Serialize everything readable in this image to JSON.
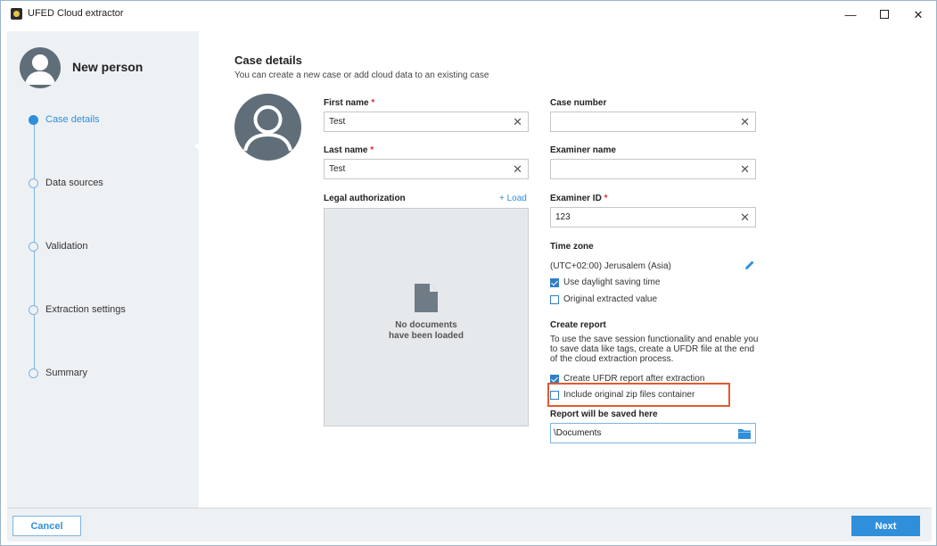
{
  "window": {
    "title": "UFED Cloud extractor",
    "minimize_glyph": "—",
    "close_glyph": "✕"
  },
  "sidebar": {
    "person_name": "New person",
    "steps": [
      {
        "label": "Case details",
        "active": true
      },
      {
        "label": "Data sources",
        "active": false
      },
      {
        "label": "Validation",
        "active": false
      },
      {
        "label": "Extraction settings",
        "active": false
      },
      {
        "label": "Summary",
        "active": false
      }
    ]
  },
  "main": {
    "title": "Case details",
    "subtitle": "You can create a new case or add cloud data to an existing case",
    "required_marker": "*",
    "clear_glyph": "✕",
    "first_name": {
      "label": "First name",
      "value": "Test"
    },
    "last_name": {
      "label": "Last name",
      "value": "Test"
    },
    "case_number": {
      "label": "Case number",
      "value": ""
    },
    "examiner_name": {
      "label": "Examiner name",
      "value": ""
    },
    "examiner_id": {
      "label": "Examiner ID",
      "value": "123"
    },
    "legal_authorization": {
      "label": "Legal authorization",
      "load_label": "+ Load",
      "empty_line1": "No documents",
      "empty_line2": "have been loaded"
    },
    "time_zone": {
      "label": "Time zone",
      "value": "(UTC+02:00)  Jerusalem  (Asia)",
      "use_dst_label": "Use daylight saving time",
      "use_dst_checked": true,
      "original_value_label": "Original extracted value",
      "original_value_checked": false
    },
    "create_report": {
      "label": "Create report",
      "description": "To use the save session functionality and enable you to save data like tags, create a UFDR file at the end of the cloud extraction process.",
      "create_ufdr_label": "Create UFDR report after extraction",
      "create_ufdr_checked": true,
      "include_zip_label": "Include original zip files container",
      "include_zip_checked": false
    },
    "save_location": {
      "label": "Report will be saved here",
      "value": "\\Documents"
    }
  },
  "footer": {
    "cancel_label": "Cancel",
    "next_label": "Next"
  },
  "colors": {
    "accent": "#2f8fdb",
    "required": "#d9283d",
    "highlight": "#e05a32",
    "sidebar_bg": "#eef1f4"
  },
  "icons": {
    "app": "ufed-app-icon",
    "person": "person-avatar-icon",
    "document": "document-icon",
    "edit": "pencil-icon",
    "folder": "folder-icon"
  }
}
